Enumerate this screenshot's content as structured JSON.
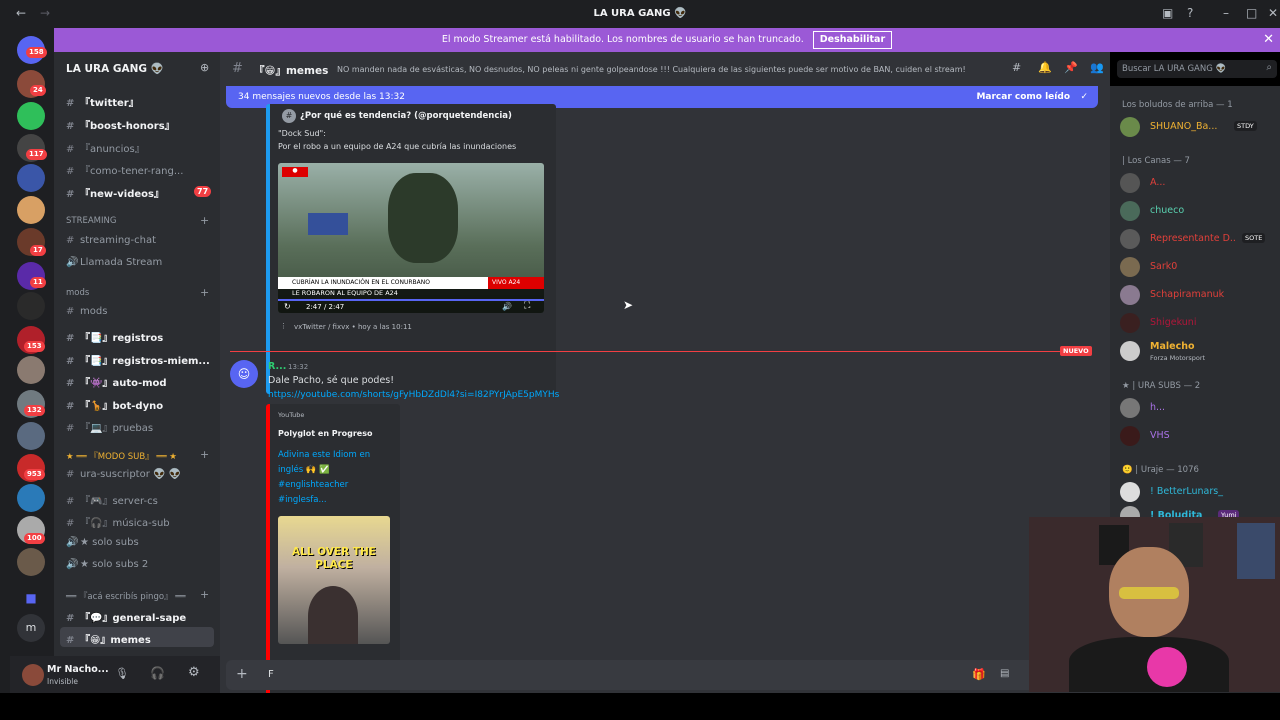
{
  "window": {
    "title": "LA URA GANG 👽"
  },
  "banner": {
    "text": "El modo Streamer está habilitado. Los nombres de usuario se han truncado.",
    "button": "Deshabilitar"
  },
  "servers": {
    "badges": [
      "158",
      "24",
      "117",
      "17",
      "11",
      "153",
      "132",
      "953",
      "100"
    ],
    "letter": "m"
  },
  "sidebar": {
    "server_name": "LA URA GANG 👽",
    "channels": [
      {
        "label": "『twitter』",
        "bold": true
      },
      {
        "label": "『boost-honors』",
        "bold": true
      },
      {
        "label": "『anuncios』",
        "bold": false
      },
      {
        "label": "『como-tener-rang...",
        "bold": false
      },
      {
        "label": "『new-videos』",
        "bold": true,
        "badge": "77"
      }
    ],
    "cat_streaming": "STREAMING",
    "streaming": [
      {
        "label": "streaming-chat"
      },
      {
        "label": "Llamada Stream"
      }
    ],
    "cat_mods": "mods",
    "mods": [
      {
        "label": "mods",
        "bold": false
      },
      {
        "label": "『📑』registros",
        "bold": true
      },
      {
        "label": "『📑』registros-miem...",
        "bold": true
      },
      {
        "label": "『👾』auto-mod",
        "bold": true
      },
      {
        "label": "『🦒』bot-dyno",
        "bold": true
      },
      {
        "label": "『💻』pruebas",
        "bold": false
      }
    ],
    "cat_sub": "★ ══ 『MODO SUB』 ══ ★",
    "sub": [
      {
        "label": "ura-suscriptor 👽 👽"
      },
      {
        "label": "『🎮』server-cs"
      },
      {
        "label": "『🎧』música-sub"
      },
      {
        "label": "★ solo subs"
      },
      {
        "label": "★ solo subs 2"
      }
    ],
    "cat_pingo": "══ 『acá escribís pingo』 ══",
    "pingo": [
      {
        "label": "『💬』general-sape",
        "bold": true
      },
      {
        "label": "『😁』memes",
        "bold": true
      }
    ]
  },
  "user": {
    "name": "Mr Nacho...",
    "status": "Invisible"
  },
  "channel": {
    "name": "『😁』memes",
    "topic": "NO manden nada de esvásticas, NO desnudos, NO peleas ni gente golpeandose !!! Cualquiera de las siguientes puede ser motivo de BAN, cuiden el stream!",
    "search_placeholder": "Buscar LA URA GANG 👽"
  },
  "new_bar": {
    "text": "34 mensajes nuevos desde las 13:32",
    "mark": "Marcar como leído"
  },
  "embed1": {
    "author": "¿Por qué es tendencia? (@porquetendencia)",
    "quote": "\"Dock Sud\":",
    "body": "Por el robo a un equipo de A24 que cubría las inundaciones",
    "video_caption": "CUBRÍAN LA INUNDACIÓN EN EL CONURBANO",
    "video_caption2": "LE ROBARON AL EQUIPO DE A24",
    "video_time": "2:47 / 2:47",
    "footer": "vxTwitter / fixvx • hoy a las 10:11",
    "vivo": "VIVO  A24"
  },
  "divider": {
    "label": "NUEVO"
  },
  "message": {
    "author": "R...",
    "time": "13:32",
    "text": "Dale Pacho, sé que podes!",
    "link": "https://youtube.com/shorts/gFyHbDZdDl4?si=I82PYrJApE5pMYHs"
  },
  "embed2": {
    "provider": "YouTube",
    "channel": "Polyglot en Progreso",
    "title": "Adivina este Idiom en inglés 🙌 ✅ #englishteacher #inglesfa...",
    "thumb_text": "ALL OVER THE PLACE"
  },
  "input": {
    "value": "F"
  },
  "members": {
    "groups": [
      {
        "title": "Los boludos de arriba — 1",
        "members": [
          {
            "name": "SHUANO_Ba...",
            "color": "#f0b232",
            "tag": "STDY"
          }
        ]
      },
      {
        "title": "| Los Canas — 7",
        "members": [
          {
            "name": "A...",
            "color": "#e0403a"
          },
          {
            "name": "chueco",
            "color": "#5ad1b0"
          },
          {
            "name": "Representante D...",
            "color": "#e0403a",
            "tag": "SOTE"
          },
          {
            "name": "Sark0",
            "color": "#e0403a"
          },
          {
            "name": "Schapiramanuk",
            "color": "#e0403a"
          },
          {
            "name": "Shigekuni",
            "color": "#b0173a"
          },
          {
            "name": "Malecho",
            "color": "#f0b232",
            "sub": "Forza Motorsport"
          }
        ]
      },
      {
        "title": "★ | URA SUBS — 2",
        "members": [
          {
            "name": "h...",
            "color": "#a972e6"
          },
          {
            "name": "VHS",
            "color": "#a972e6"
          }
        ]
      },
      {
        "title": "🙂 | Uraje — 1076",
        "members": [
          {
            "name": "! BetterLunars_",
            "color": "#2fb8d8"
          },
          {
            "name": "! Boludita",
            "color": "#2fb8d8",
            "tag": "Yumi"
          }
        ]
      }
    ]
  }
}
